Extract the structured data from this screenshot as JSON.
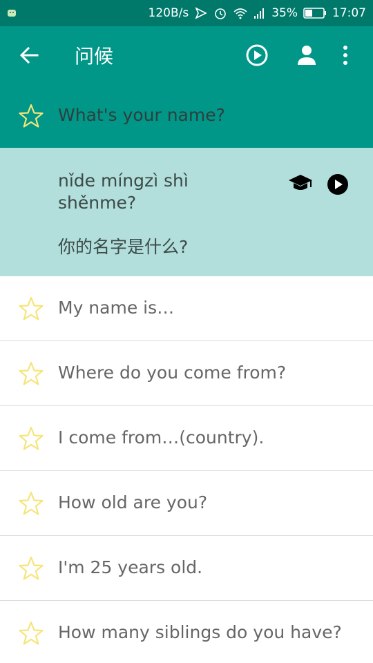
{
  "status": {
    "speed": "120B/s",
    "battery": "35%",
    "time": "17:07"
  },
  "appbar": {
    "title": "问候"
  },
  "selected": {
    "english": "What's your name?",
    "pinyin": "nǐde míngzì shì shěnme?",
    "hanzi": "你的名字是什么?"
  },
  "phrases": [
    {
      "english": "My name is…"
    },
    {
      "english": "Where do you come from?"
    },
    {
      "english": "I come from…(country)."
    },
    {
      "english": "How old are you?"
    },
    {
      "english": "I'm 25 years old."
    },
    {
      "english": "How many siblings do you have?"
    }
  ],
  "colors": {
    "primary": "#009688",
    "primary_dark": "#00796b",
    "selected_bg": "#b2dfdb",
    "star_outline": "#f5e57a"
  }
}
